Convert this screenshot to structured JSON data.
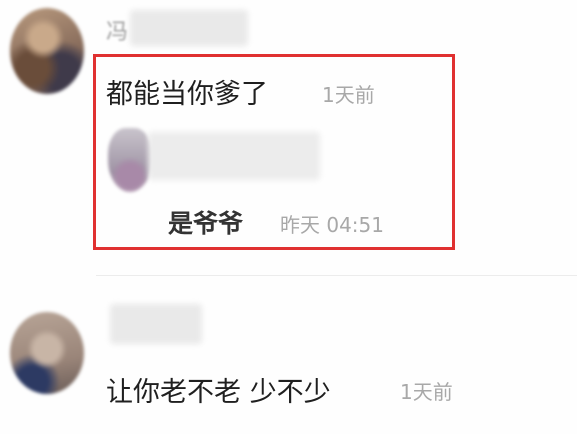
{
  "comments": [
    {
      "username_visible": "冯",
      "text": "都能当你爹了",
      "time": "1天前",
      "reply": {
        "text": "是爷爷",
        "time": "昨天 04:51"
      }
    },
    {
      "text": "让你老不老 少不少",
      "time": "1天前"
    }
  ],
  "colors": {
    "highlight_border": "#e03030",
    "time_text": "#a8a8a8",
    "comment_text": "#1f1f1f"
  }
}
